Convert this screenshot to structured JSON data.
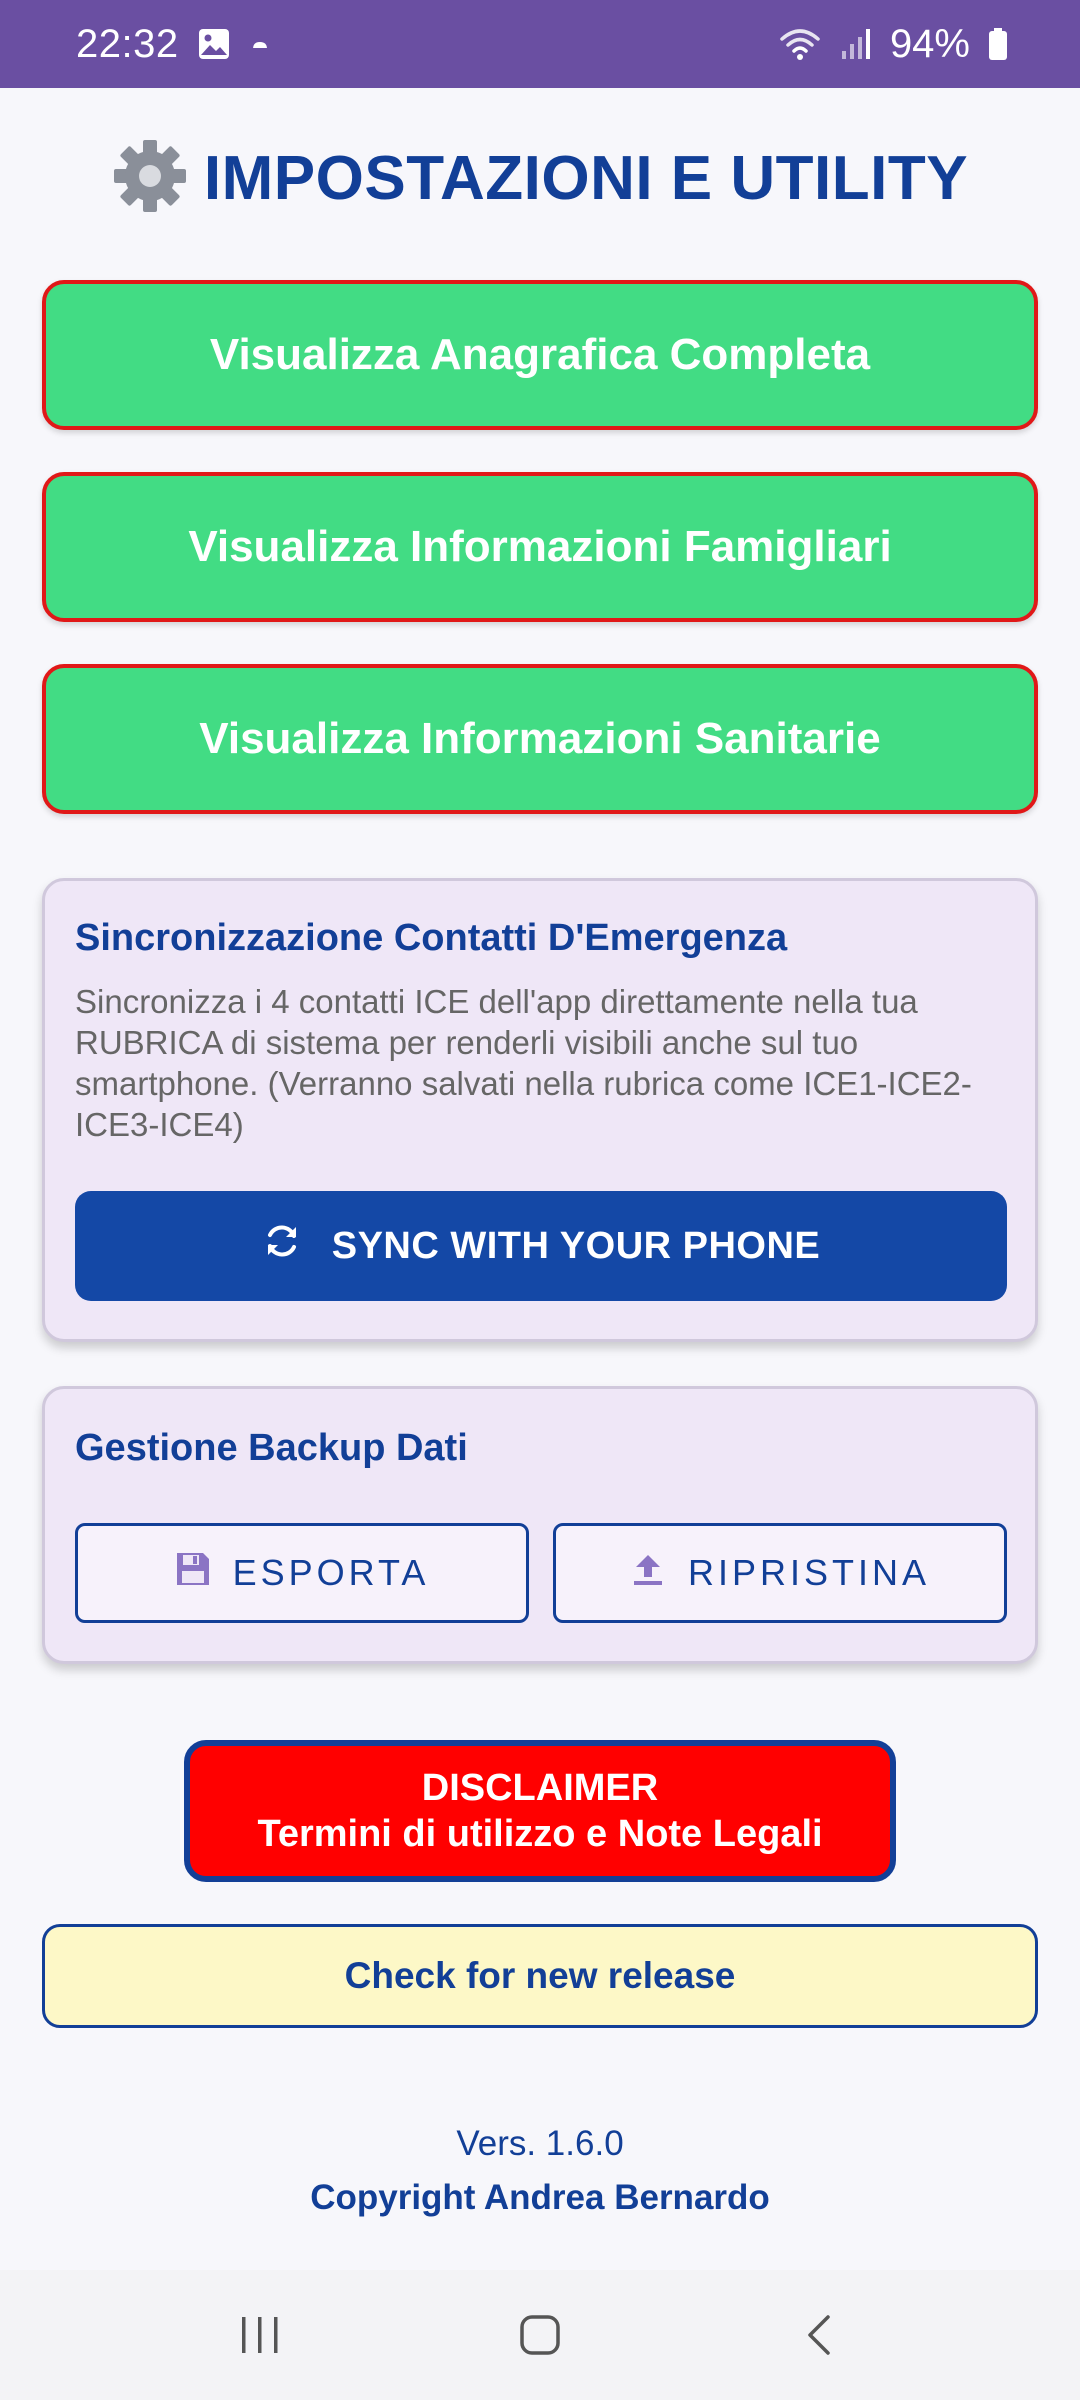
{
  "status_bar": {
    "time": "22:32",
    "battery_text": "94%",
    "icons": [
      "gallery-icon",
      "cloud-icon",
      "wifi-icon",
      "signal-icon",
      "battery-icon"
    ]
  },
  "header": {
    "title": "IMPOSTAZIONI E UTILITY",
    "icon": "gear-icon"
  },
  "main_buttons": [
    {
      "label": "Visualizza Anagrafica Completa"
    },
    {
      "label": "Visualizza Informazioni Famigliari"
    },
    {
      "label": "Visualizza Informazioni Sanitarie"
    }
  ],
  "sync_card": {
    "title": "Sincronizzazione Contatti D'Emergenza",
    "description": "Sincronizza i 4 contatti ICE dell'app direttamente nella tua RUBRICA di sistema per renderli visibili anche sul tuo smartphone. (Verranno salvati nella rubrica come ICE1-ICE2-ICE3-ICE4)",
    "button_label": "SYNC WITH YOUR PHONE",
    "button_icon": "sync-icon"
  },
  "backup_card": {
    "title": "Gestione Backup Dati",
    "export_label": "ESPORTA",
    "export_icon": "save-icon",
    "restore_label": "RIPRISTINA",
    "restore_icon": "upload-icon"
  },
  "disclaimer": {
    "line1": "DISCLAIMER",
    "line2": "Termini di utilizzo e Note Legali"
  },
  "release_button": "Check for new release",
  "footer": {
    "version": "Vers. 1.6.0",
    "copyright": "Copyright Andrea Bernardo"
  },
  "colors": {
    "status_bar": "#6a4fa2",
    "primary_blue": "#123f97",
    "green_button": "#42dc84",
    "red_border": "#e01818",
    "disclaimer_red": "#ff0000",
    "card_bg": "#efe7f7",
    "release_bg": "#fdf8c7"
  }
}
